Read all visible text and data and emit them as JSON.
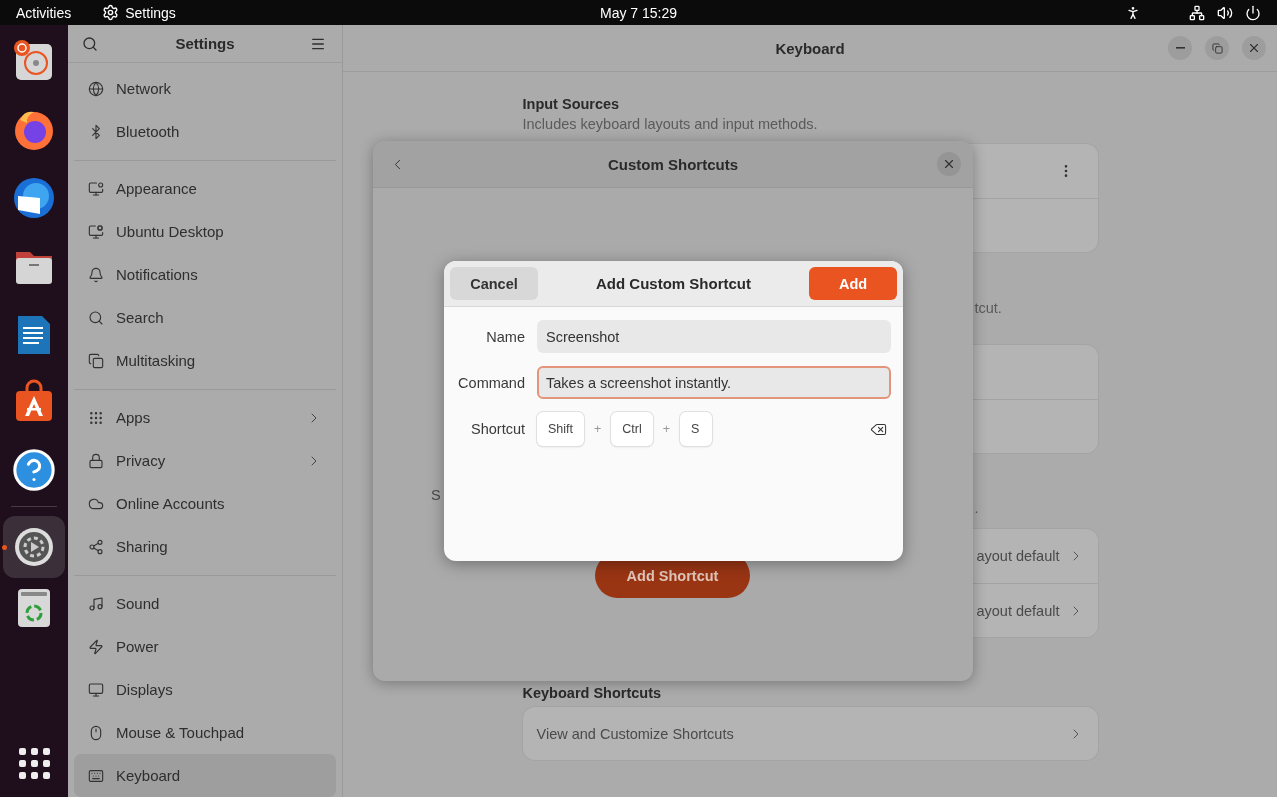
{
  "top_bar": {
    "activities": "Activities",
    "app_name": "Settings",
    "clock": "May 7  15:29"
  },
  "dock": {
    "items": [
      {
        "selected": false,
        "running": false
      },
      {
        "selected": false,
        "running": false
      },
      {
        "selected": false,
        "running": false
      },
      {
        "selected": false,
        "running": false
      },
      {
        "selected": false,
        "running": false
      },
      {
        "selected": false,
        "running": false
      },
      {
        "selected": false,
        "running": false
      },
      {
        "selected": true,
        "running": true
      },
      {
        "selected": false,
        "running": false
      }
    ]
  },
  "sidebar": {
    "title": "Settings",
    "groups": [
      [
        {
          "label": "Network",
          "selected": false,
          "submenu": false
        },
        {
          "label": "Bluetooth",
          "selected": false,
          "submenu": false
        }
      ],
      [
        {
          "label": "Appearance",
          "selected": false,
          "submenu": false
        },
        {
          "label": "Ubuntu Desktop",
          "selected": false,
          "submenu": false
        },
        {
          "label": "Notifications",
          "selected": false,
          "submenu": false
        },
        {
          "label": "Search",
          "selected": false,
          "submenu": false
        },
        {
          "label": "Multitasking",
          "selected": false,
          "submenu": false
        }
      ],
      [
        {
          "label": "Apps",
          "selected": false,
          "submenu": true
        },
        {
          "label": "Privacy",
          "selected": false,
          "submenu": true
        },
        {
          "label": "Online Accounts",
          "selected": false,
          "submenu": false
        },
        {
          "label": "Sharing",
          "selected": false,
          "submenu": false
        }
      ],
      [
        {
          "label": "Sound",
          "selected": false,
          "submenu": false
        },
        {
          "label": "Power",
          "selected": false,
          "submenu": false
        },
        {
          "label": "Displays",
          "selected": false,
          "submenu": false
        },
        {
          "label": "Mouse & Touchpad",
          "selected": false,
          "submenu": false
        },
        {
          "label": "Keyboard",
          "selected": true,
          "submenu": false
        }
      ]
    ]
  },
  "window": {
    "title": "Keyboard"
  },
  "main": {
    "input_sources": {
      "heading": "Input Sources",
      "description": "Includes keyboard layouts and input methods."
    },
    "section_2": {
      "description_fragment": "tcut."
    },
    "section_3": {
      "description_fragment": ".",
      "rows": [
        {
          "value": "ayout default"
        },
        {
          "value": "ayout default"
        }
      ]
    },
    "keyboard_shortcuts": {
      "heading": "Keyboard Shortcuts",
      "rows": [
        {
          "label": "View and Customize Shortcuts"
        }
      ]
    }
  },
  "custom_shortcuts_dialog": {
    "title": "Custom Shortcuts",
    "text_fragment": "S",
    "add_button": "Add Shortcut"
  },
  "add_dialog": {
    "title": "Add Custom Shortcut",
    "cancel": "Cancel",
    "add": "Add",
    "fields": [
      {
        "label": "Name",
        "value": "Screenshot",
        "focused": false
      },
      {
        "label": "Command",
        "value": "Takes a screenshot instantly.",
        "focused": true
      }
    ],
    "shortcut": {
      "label": "Shortcut",
      "items": [
        {
          "kind": "key",
          "text": "Shift"
        },
        {
          "kind": "plus",
          "text": "+"
        },
        {
          "kind": "key",
          "text": "Ctrl"
        },
        {
          "kind": "plus",
          "text": "+"
        },
        {
          "kind": "key",
          "text": "S"
        }
      ]
    }
  }
}
